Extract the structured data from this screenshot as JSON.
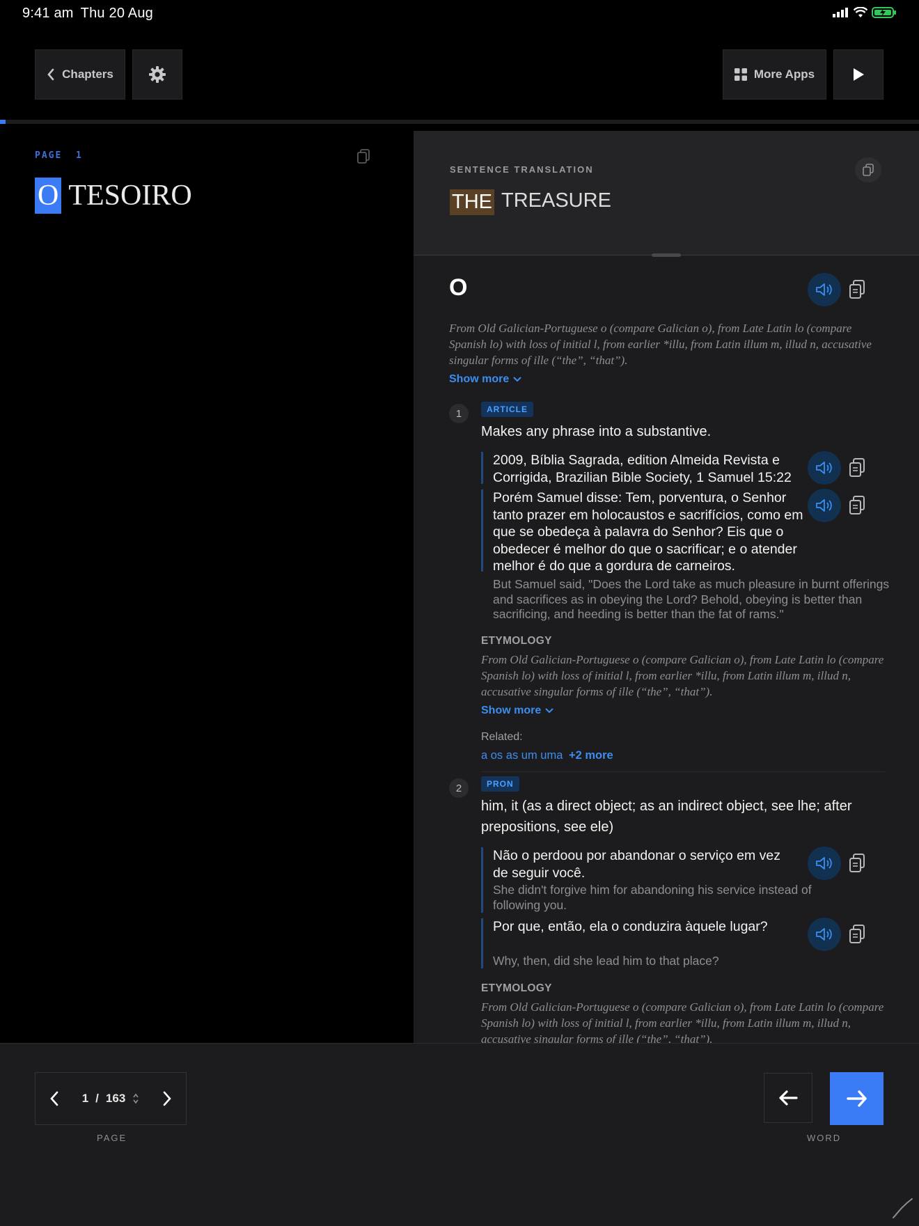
{
  "status": {
    "time": "9:41 am",
    "date": "Thu 20 Aug"
  },
  "toolbar": {
    "chapters_label": "Chapters",
    "more_apps_label": "More Apps"
  },
  "reader": {
    "page_label": "PAGE  1",
    "title_highlight": "O",
    "title_rest": "TESOIRO",
    "progress_fraction": 0.006
  },
  "translation": {
    "header": "SENTENCE TRANSLATION",
    "highlight": "THE",
    "rest": "TREASURE"
  },
  "entry": {
    "word": "O",
    "etymology_intro": "From Old Galician-Portuguese o (compare Galician o), from Late Latin lo (compare Spanish lo) with loss of initial l, from earlier *illu, from Latin illum m, illud n, accusative singular forms of ille (“the”, “that”).",
    "show_more": "Show more",
    "senses": [
      {
        "number": "1",
        "pos": "ARTICLE",
        "definition": "Makes any phrase into a substantive.",
        "citation": "2009, Bíblia Sagrada, edition Almeida Revista e Corrigida, Brazilian Bible Society, 1 Samuel 15:22",
        "quote": "Porém Samuel disse: Tem, porventura, o Senhor tanto prazer em holocaustos e sacrifícios, como em que se obedeça à palavra do Senhor? Eis que o obedecer é melhor do que o sacrificar; e o atender melhor é do que a gordura de carneiros.",
        "quote_translation": "But Samuel said, \"Does the Lord take as much pleasure in burnt offerings and sacrifices as in obeying the Lord? Behold, obeying is better than sacrificing, and heeding is better than the fat of rams.\"",
        "etymology_header": "ETYMOLOGY",
        "etymology": "From Old Galician-Portuguese o (compare Galician o), from Late Latin lo (compare Spanish lo) with loss of initial l, from earlier *illu, from Latin illum m, illud n, accusative singular forms of ille (“the”, “that”).",
        "show_more": "Show more",
        "related_header": "Related:",
        "related_words": "a os as um uma",
        "related_more": "+2 more"
      },
      {
        "number": "2",
        "pos": "PRON",
        "definition": "him, it (as a direct object; as an indirect object, see lhe; after prepositions, see ele)",
        "example1": "Não o perdoou por abandonar o serviço em vez de seguir você.",
        "example1_translation": "She didn't forgive him for abandoning his service instead of following you.",
        "example2": "Por que, então, ela o conduzira àquele lugar?",
        "example2_translation": "Why, then, did she lead him to that place?",
        "etymology_header": "ETYMOLOGY",
        "etymology": "From Old Galician-Portuguese o (compare Galician o), from Late Latin lo (compare Spanish lo) with loss of initial l, from earlier *illu, from Latin illum m, illud n, accusative singular forms of ille (“the”, “that”)."
      }
    ]
  },
  "pager": {
    "current": "1",
    "separator": "/",
    "total": "163",
    "caption": "PAGE"
  },
  "word_nav": {
    "caption": "WORD"
  },
  "colors": {
    "accent": "#3b7cf6",
    "link": "#3b8ef0",
    "panel": "#1c1c1e",
    "translation_highlight": "#5a4126"
  },
  "icons": [
    "chevron-left-icon",
    "gear-icon",
    "grid-icon",
    "play-icon",
    "copy-icon",
    "speaker-icon",
    "chevron-down-icon",
    "arrow-left-icon",
    "arrow-right-icon",
    "chevron-right-icon",
    "updown-icon",
    "signal-icon",
    "wifi-icon",
    "battery-icon"
  ]
}
